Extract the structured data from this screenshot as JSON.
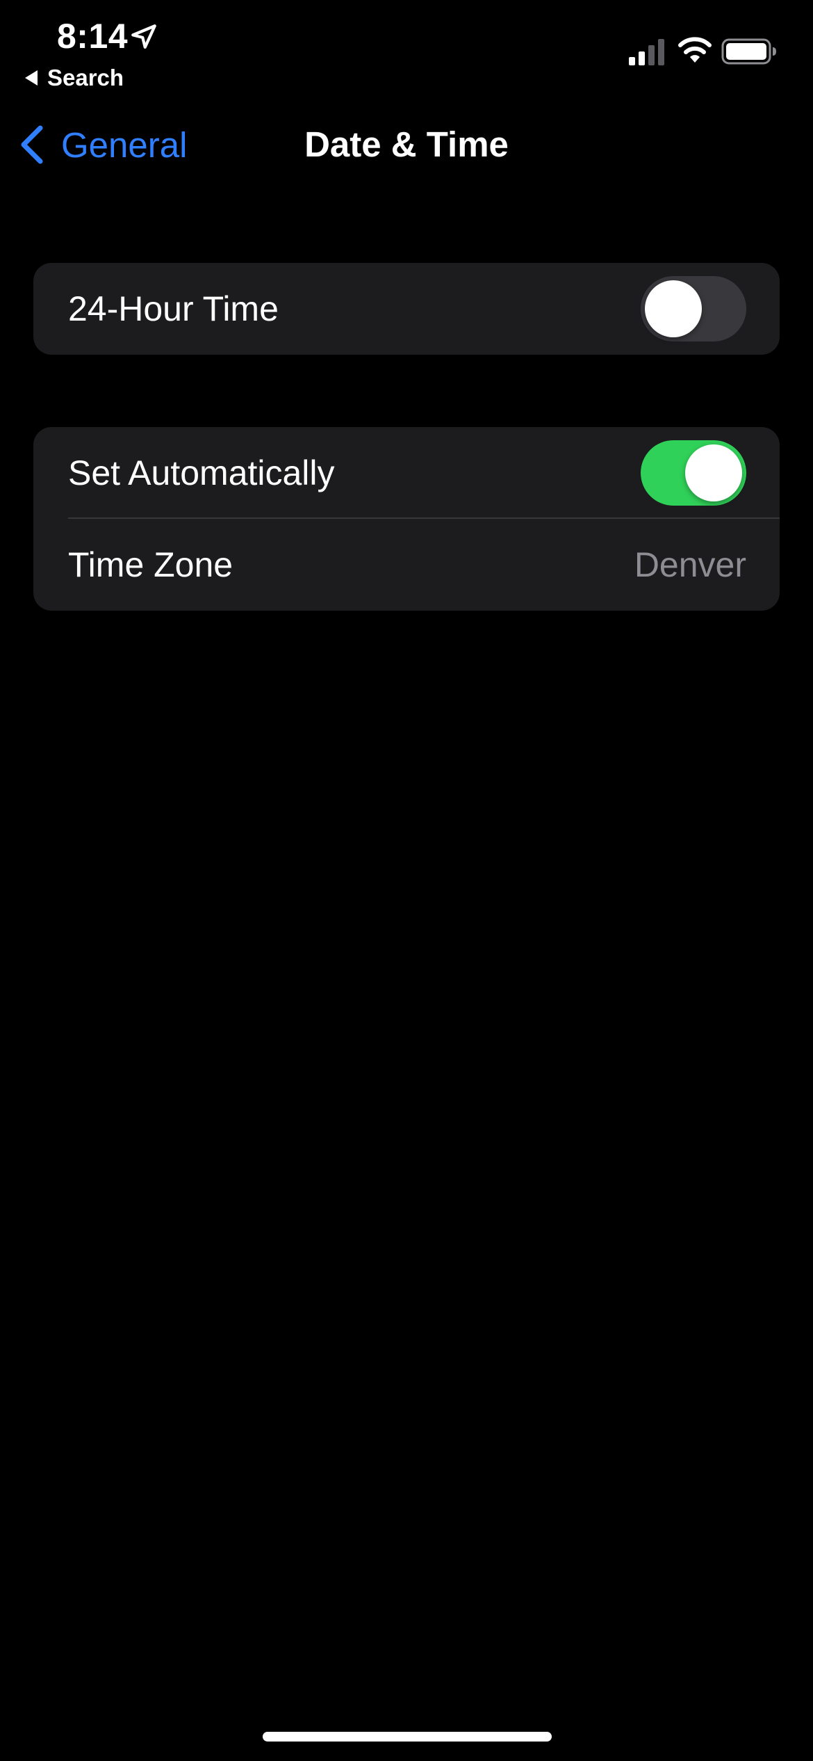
{
  "status_bar": {
    "time": "8:14",
    "back_app": "Search",
    "icons": [
      "location-arrow-icon",
      "cellular-signal-icon",
      "wifi-icon",
      "battery-icon"
    ]
  },
  "nav": {
    "back_label": "General",
    "title": "Date & Time"
  },
  "settings": {
    "hour24": {
      "label": "24-Hour Time",
      "enabled": false
    },
    "set_automatically": {
      "label": "Set Automatically",
      "enabled": true
    },
    "time_zone": {
      "label": "Time Zone",
      "value": "Denver"
    }
  },
  "colors": {
    "background": "#000000",
    "group_background": "#1c1c1e",
    "accent_blue": "#2f7fff",
    "toggle_on": "#30d158",
    "toggle_off": "#39393d",
    "secondary_text": "#8d8d93"
  }
}
